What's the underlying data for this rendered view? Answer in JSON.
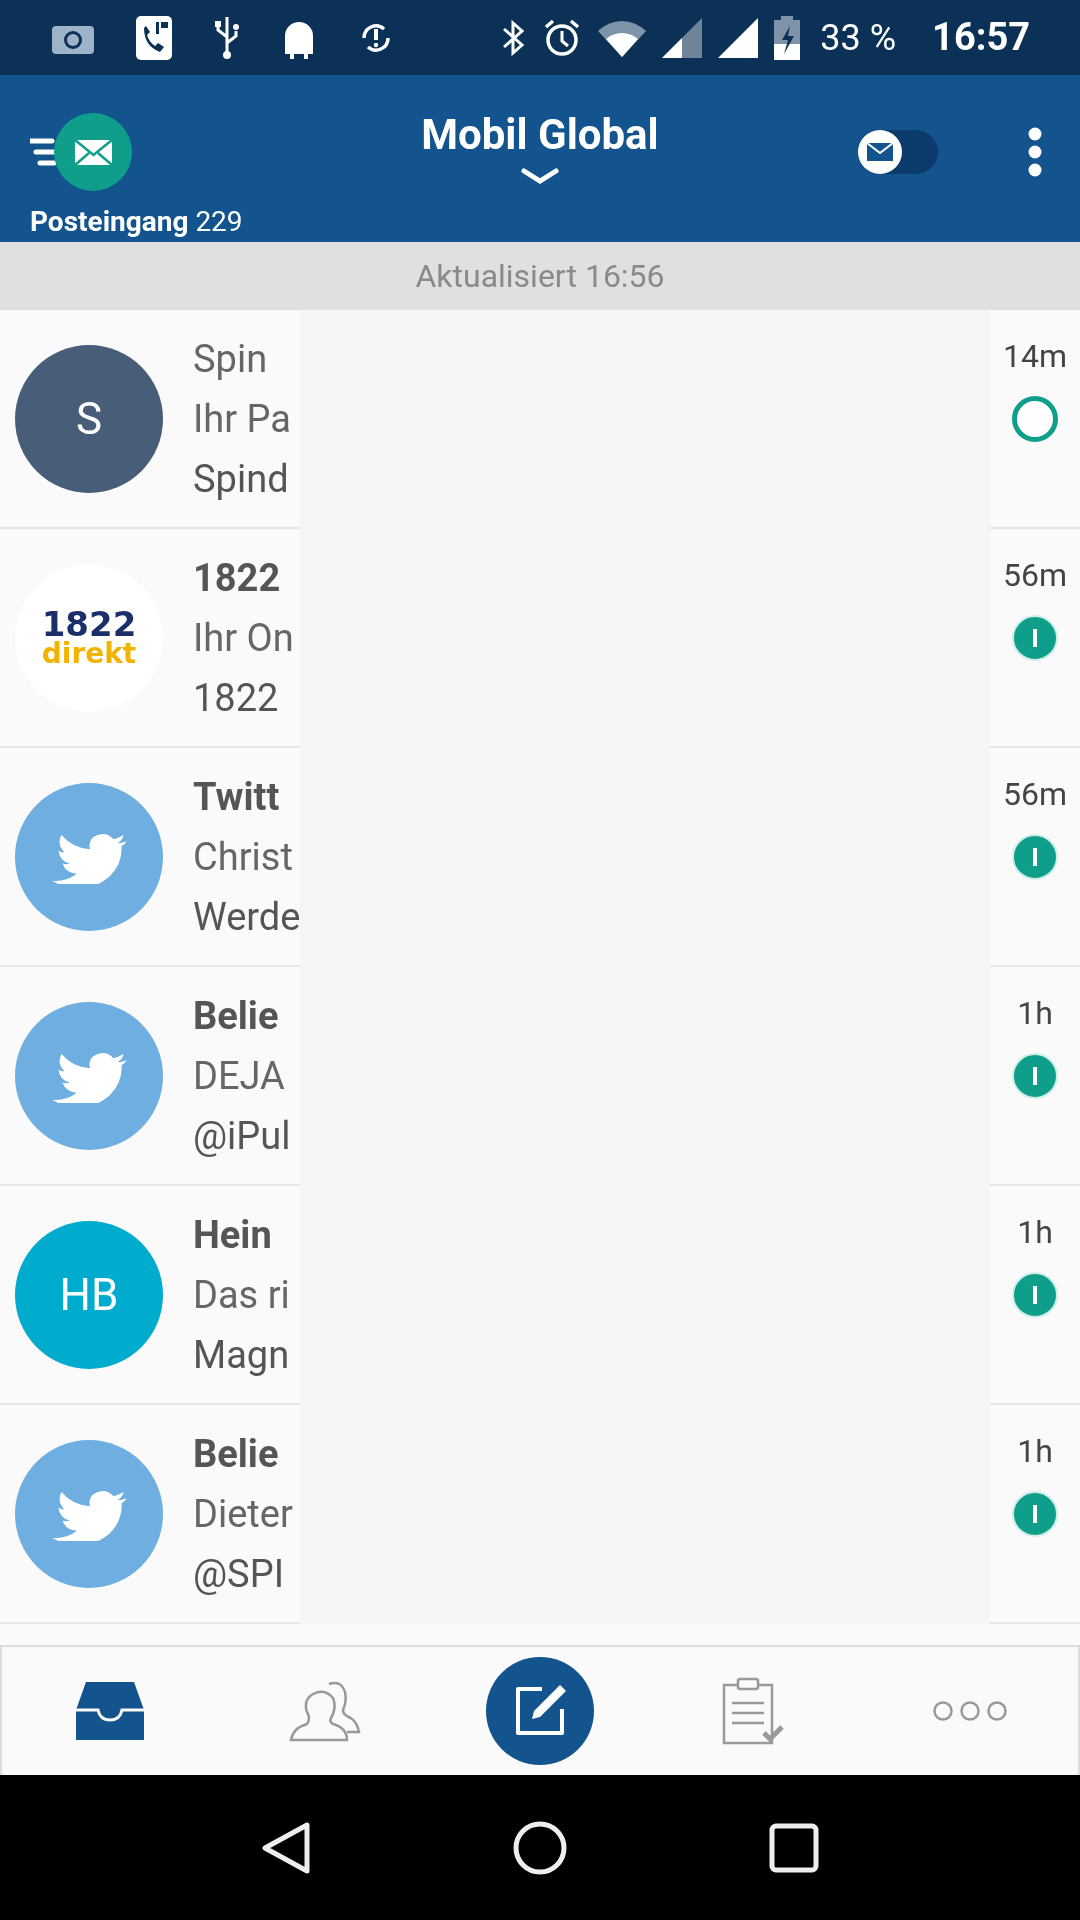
{
  "status_bar": {
    "battery": "33 %",
    "time": "16:57"
  },
  "header": {
    "title": "Mobil Global",
    "folder": "Posteingang",
    "count": "229",
    "mail_toggle": {
      "on": false
    }
  },
  "sync_banner": "Aktualisiert 16:56",
  "messages": [
    {
      "avatar": {
        "kind": "letter",
        "text": "S",
        "color": "#485d78"
      },
      "sender": "Spin",
      "line_1": "Ihr Pa",
      "line_2": "Spind",
      "age": "14m",
      "unread": false
    },
    {
      "avatar": {
        "kind": "logo",
        "text": "1822",
        "subtext": "direkt"
      },
      "sender": "1822",
      "line_1": "Ihr On",
      "line_2": "1822",
      "age": "56m",
      "unread": true
    },
    {
      "avatar": {
        "kind": "bird"
      },
      "sender": "Twitt",
      "line_1": "Christ",
      "line_2": "Werde",
      "age": "56m",
      "unread": true
    },
    {
      "avatar": {
        "kind": "bird"
      },
      "sender": "Belie",
      "line_1": "DEJA",
      "line_2": "@iPul",
      "age": "1h",
      "unread": true
    },
    {
      "avatar": {
        "kind": "letter",
        "text": "HB",
        "color": "#00acce"
      },
      "sender": "Hein",
      "line_1": "Das ri",
      "line_2": "Magn",
      "age": "1h",
      "unread": true
    },
    {
      "avatar": {
        "kind": "bird"
      },
      "sender": "Belie",
      "line_1": "Dieter",
      "line_2": "@SPI",
      "age": "1h",
      "unread": true
    }
  ],
  "bottom_tabs": [
    {
      "kind": "inbox",
      "selected": true
    },
    {
      "kind": "contacts",
      "selected": false
    },
    {
      "kind": "compose",
      "selected": false
    },
    {
      "kind": "tasks",
      "selected": false
    },
    {
      "kind": "more",
      "selected": false
    }
  ]
}
